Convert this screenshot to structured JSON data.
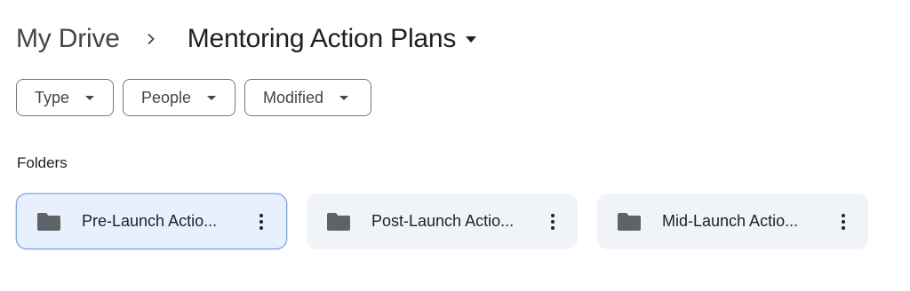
{
  "breadcrumb": {
    "root": "My Drive",
    "separator_icon": "chevron-right-icon",
    "current": "Mentoring Action Plans",
    "current_menu_icon": "caret-down-icon"
  },
  "filters": [
    {
      "label": "Type",
      "icon": "caret-down-icon"
    },
    {
      "label": "People",
      "icon": "caret-down-icon"
    },
    {
      "label": "Modified",
      "icon": "caret-down-icon"
    }
  ],
  "folders_section": {
    "heading": "Folders",
    "items": [
      {
        "name": "Pre-Launch Actio...",
        "icon": "folder-icon",
        "menu_icon": "more-vert-icon",
        "selected": true
      },
      {
        "name": "Post-Launch Actio...",
        "icon": "folder-icon",
        "menu_icon": "more-vert-icon",
        "selected": false
      },
      {
        "name": "Mid-Launch Actio...",
        "icon": "folder-icon",
        "menu_icon": "more-vert-icon",
        "selected": false
      }
    ]
  },
  "colors": {
    "text_primary": "#1f1f1f",
    "text_secondary": "#444746",
    "chip_border": "#747775",
    "card_bg": "#f0f4f9",
    "card_selected_bg": "#e8f0fe",
    "card_selected_border": "#7fa6d8",
    "icon_gray": "#5f6368"
  }
}
